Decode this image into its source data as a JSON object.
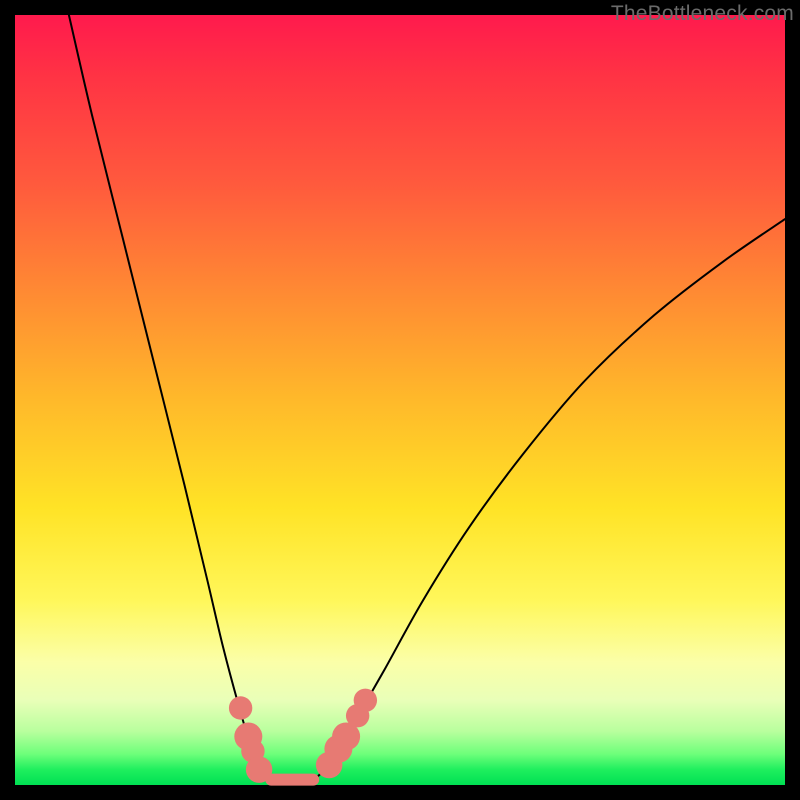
{
  "watermark": "TheBottleneck.com",
  "chart_data": {
    "type": "line",
    "title": "",
    "xlabel": "",
    "ylabel": "",
    "xlim": [
      0,
      100
    ],
    "ylim": [
      0,
      100
    ],
    "grid": false,
    "legend": false,
    "background_gradient": {
      "top": "#ff1a4d",
      "mid": "#ffe326",
      "bottom": "#00e053"
    },
    "series": [
      {
        "name": "left-branch",
        "comment": "steep descending branch from top-left into the valley",
        "x": [
          7,
          10,
          14,
          18,
          22,
          25,
          27,
          29,
          30.5,
          32,
          33
        ],
        "y": [
          100,
          87,
          71,
          55,
          39,
          26.5,
          18,
          10.5,
          5.5,
          2,
          0.8
        ]
      },
      {
        "name": "right-branch",
        "comment": "rising branch from valley toward upper-right, sub-linear",
        "x": [
          39,
          41,
          44,
          48,
          53,
          59,
          66,
          74,
          83,
          92,
          100
        ],
        "y": [
          0.8,
          3,
          8,
          15,
          24,
          33.5,
          43,
          52.5,
          61,
          68,
          73.5
        ]
      }
    ],
    "valley_floor": {
      "comment": "flat pill segment at the bottom of the V",
      "x_start": 32.5,
      "x_end": 39.5,
      "y": 0.7
    },
    "markers": {
      "comment": "salmon dots near valley on both branches",
      "points": [
        {
          "x": 29.3,
          "y": 10.0,
          "r": 1.0
        },
        {
          "x": 30.3,
          "y": 6.3,
          "r": 1.3
        },
        {
          "x": 30.9,
          "y": 4.4,
          "r": 1.0
        },
        {
          "x": 31.7,
          "y": 2.0,
          "r": 1.2
        },
        {
          "x": 40.8,
          "y": 2.6,
          "r": 1.2
        },
        {
          "x": 42.0,
          "y": 4.7,
          "r": 1.3
        },
        {
          "x": 43.0,
          "y": 6.3,
          "r": 1.3
        },
        {
          "x": 44.5,
          "y": 9.0,
          "r": 1.0
        },
        {
          "x": 45.5,
          "y": 11.0,
          "r": 1.0
        }
      ]
    }
  }
}
